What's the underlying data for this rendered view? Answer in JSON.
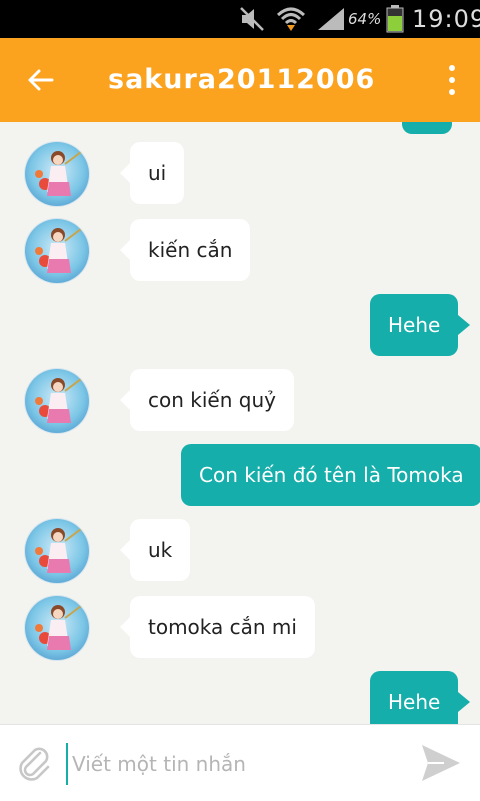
{
  "status_bar": {
    "battery_percent": "64%",
    "time": "19:09"
  },
  "header": {
    "title": "sakura20112006"
  },
  "colors": {
    "accent": "#fba21f",
    "outgoing_bubble": "#16aeaa",
    "incoming_bubble": "#ffffff",
    "background": "#f3f3ef"
  },
  "messages": [
    {
      "direction": "in",
      "text": "ui"
    },
    {
      "direction": "in",
      "text": "kiến cắn"
    },
    {
      "direction": "out",
      "text": "Hehe"
    },
    {
      "direction": "in",
      "text": "con kiến quỷ"
    },
    {
      "direction": "out",
      "text": "Con kiến đó tên là Tomoka"
    },
    {
      "direction": "in",
      "text": "uk"
    },
    {
      "direction": "in",
      "text": "tomoka cắn mi"
    },
    {
      "direction": "out",
      "text": "Hehe"
    }
  ],
  "composer": {
    "placeholder": "Viết một tin nhắn",
    "value": ""
  },
  "icons": {
    "back": "arrow-left-icon",
    "menu": "more-vert-icon",
    "attach": "paperclip-icon",
    "send": "send-icon"
  }
}
